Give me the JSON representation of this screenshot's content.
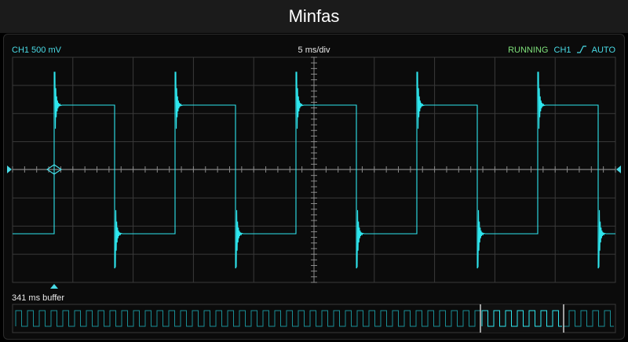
{
  "app": {
    "title": "Minfas"
  },
  "status": {
    "channel_scale": "CH1 500 mV",
    "timebase": "5 ms/div",
    "run_state": "RUNNING",
    "trigger_channel": "CH1",
    "trigger_mode": "AUTO",
    "trigger_edge_icon": "rising-edge-icon"
  },
  "buffer": {
    "label": "341 ms buffer"
  },
  "colors": {
    "trace": "#2ee6ee",
    "grid": "#3a3a3a",
    "running": "#7ee07a",
    "marker": "#49dbe6"
  }
}
